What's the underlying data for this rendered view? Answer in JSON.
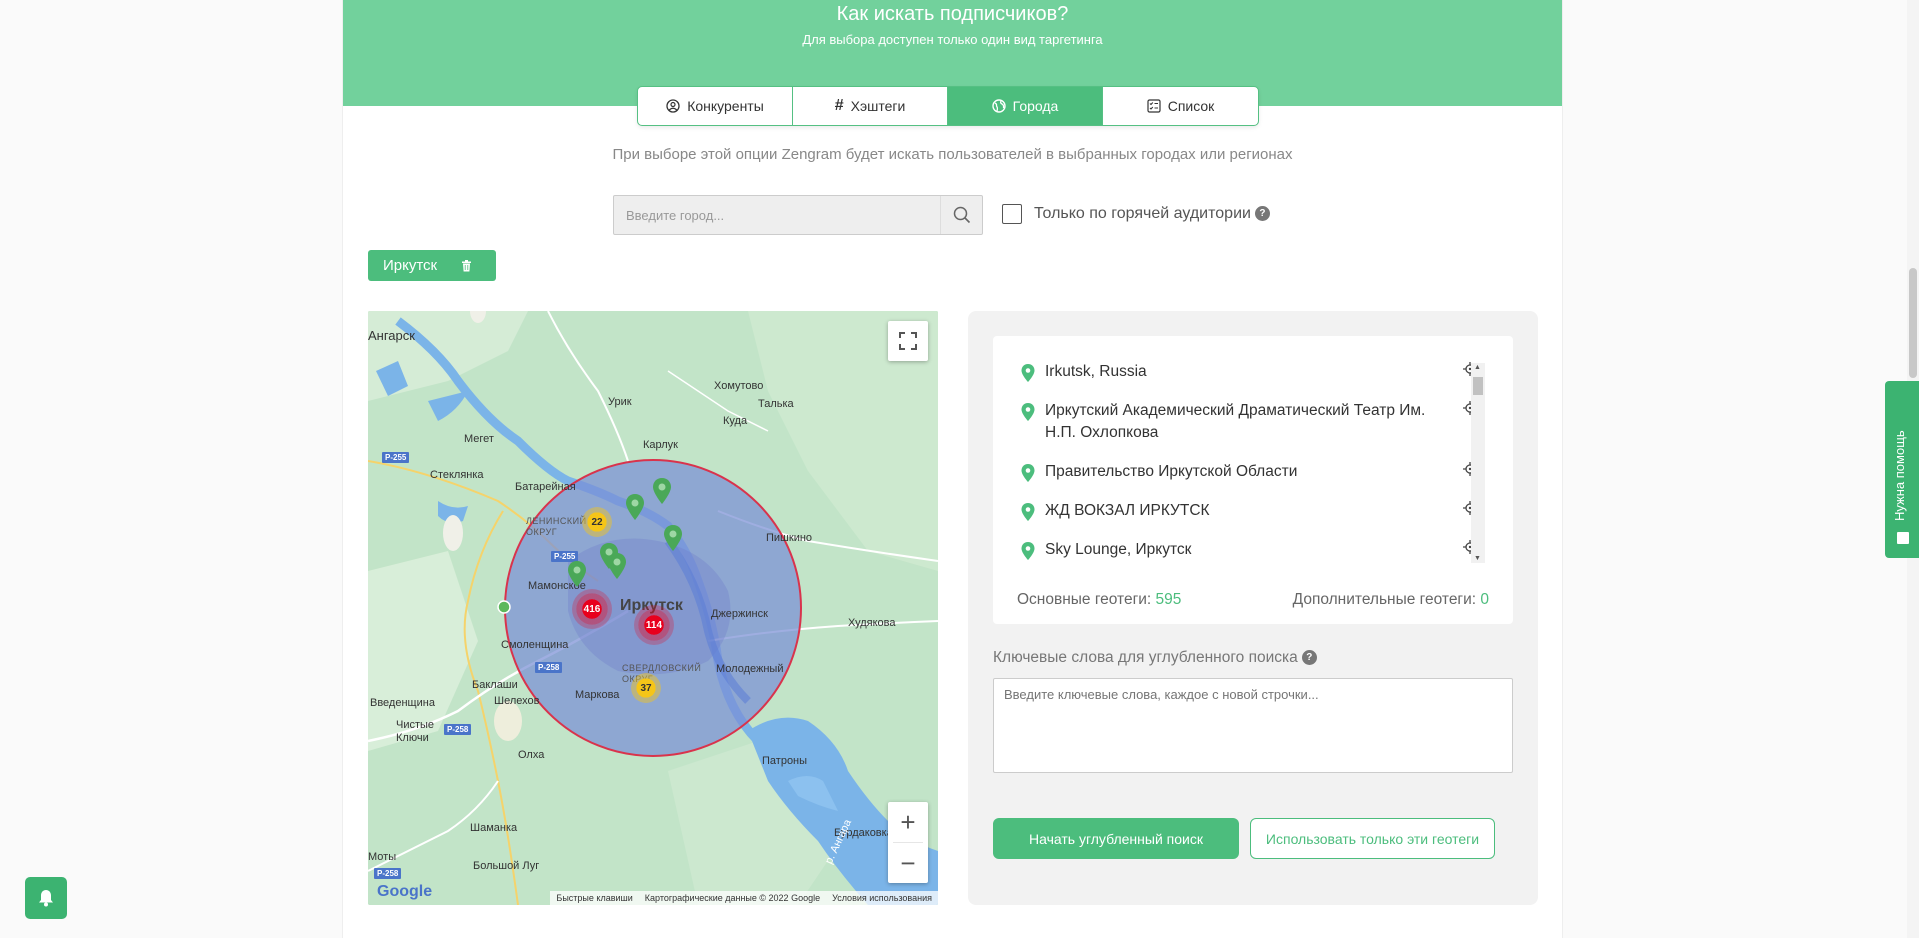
{
  "banner": {
    "title": "Как искать подписчиков?",
    "subtitle": "Для выбора доступен только один вид таргетинга"
  },
  "tabs": [
    {
      "label": "Конкуренты",
      "icon": "user-circle-icon",
      "active": false
    },
    {
      "label": "Хэштеги",
      "icon": "hash-icon",
      "active": false
    },
    {
      "label": "Города",
      "icon": "globe-icon",
      "active": true
    },
    {
      "label": "Список",
      "icon": "checklist-icon",
      "active": false
    }
  ],
  "hint": "При выборе этой опции Zengram будет искать пользователей в выбранных городах или регионах",
  "search": {
    "placeholder": "Введите город...",
    "hot_label": "Только по горячей аудитории",
    "hot_checked": false
  },
  "selected_city": {
    "label": "Иркутск"
  },
  "map": {
    "labels": {
      "angarsk": "Ангарск",
      "urik": "Урик",
      "khomutovo": "Хомутово",
      "talka": "Талька",
      "kuda": "Куда",
      "karluk": "Карлук",
      "meget": "Мегет",
      "steklyanka": "Стеклянка",
      "batareynaya": "Батарейная",
      "leninsky": "ЛЕНИНСКИЙ ОКРУГ",
      "pishkino": "Пишкино",
      "mamonskoe": "Мамонское",
      "irkutsk": "Иркутск",
      "zherzhinsk": "Джержинск",
      "khudyakova": "Худякова",
      "smolenshchina": "Смоленщина",
      "sverdlovsky": "СВЕРДЛОВСКИЙ ОКРУГ",
      "molodezhny": "Молодежный",
      "baklashi": "Баклаши",
      "shelekhov": "Шелехов",
      "vvedenshchina": "Введенщина",
      "markova": "Маркова",
      "chistye_klyuchi": "Чистые Ключи",
      "olkha": "Олха",
      "patrony": "Патроны",
      "shamanka": "Шаманка",
      "burdakovka": "Бурдаковка",
      "bolshoy_lug": "Большой Луг",
      "moty": "Моты",
      "angara": "р. Ангара"
    },
    "roads": {
      "r255a": "P-255",
      "r255b": "P-255",
      "r258a": "P-258",
      "r258b": "P-258",
      "r258c": "P-258"
    },
    "clusters": {
      "c1": "22",
      "c2": "416",
      "c3": "114",
      "c4": "37"
    },
    "attribution": {
      "shortcuts": "Быстрые клавиши",
      "data": "Картографические данные © 2022 Google",
      "terms": "Условия использования"
    },
    "google": "Google",
    "colors": {
      "radius_fill": "#7a8fd6",
      "radius_stroke": "#d9334c",
      "pin": "#4aa858",
      "cluster_yellow": "#f5c518",
      "cluster_red": "#e8001d"
    }
  },
  "places": [
    {
      "name": "Irkutsk, Russia"
    },
    {
      "name": "Иркутский Академический Драматический Театр Им. Н.П. Охлопкова"
    },
    {
      "name": "Правительство Иркутской Области"
    },
    {
      "name": "ЖД ВОКЗАЛ ИРКУТСК"
    },
    {
      "name": "Sky Lounge, Иркутск"
    }
  ],
  "stats": {
    "main_label": "Основные геотеги:",
    "main_value": "595",
    "extra_label": "Дополнительные геотеги:",
    "extra_value": "0"
  },
  "keywords": {
    "label": "Ключевые слова для углубленного поиска",
    "placeholder": "Введите ключевые слова, каждое с новой строчки..."
  },
  "buttons": {
    "deep_search": "Начать углубленный поиск",
    "use_only": "Использовать только эти геотеги"
  },
  "help": {
    "label": "Нужна помощь"
  }
}
